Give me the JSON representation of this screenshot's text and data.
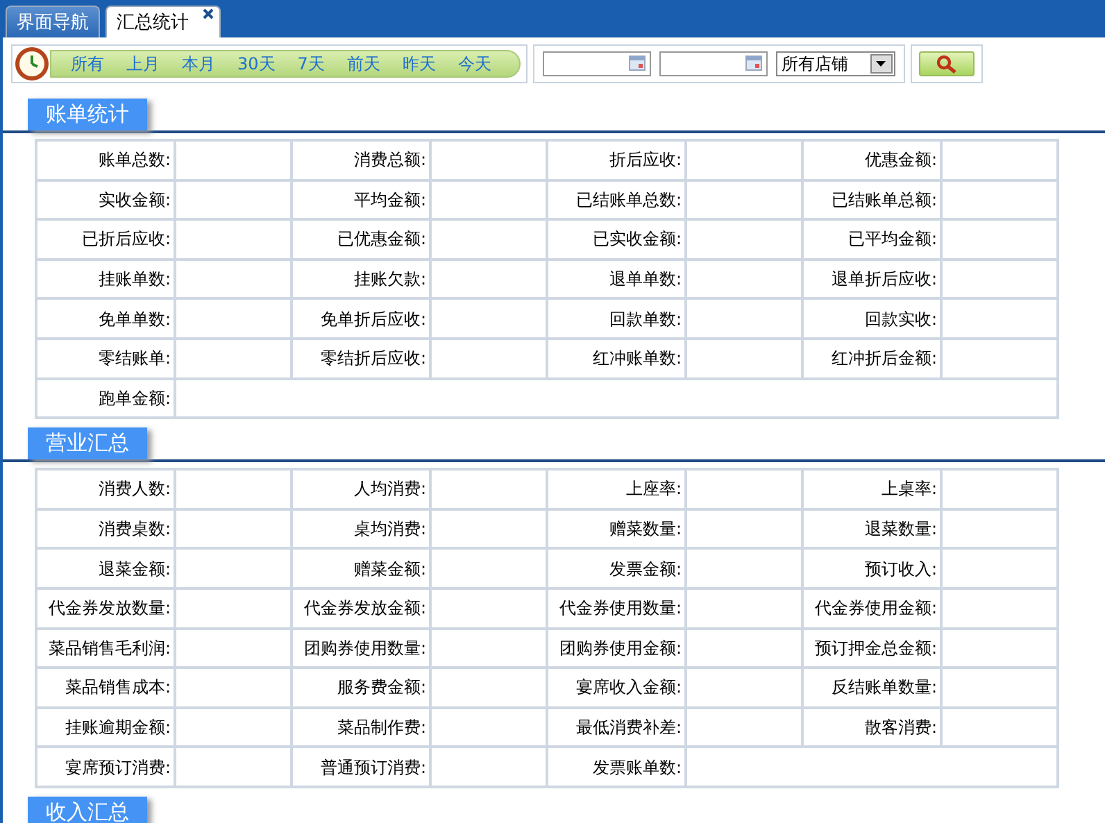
{
  "tabs": [
    {
      "label": "界面导航",
      "selected": false,
      "closable": false
    },
    {
      "label": "汇总统计",
      "selected": true,
      "closable": true
    }
  ],
  "toolbar": {
    "quick_ranges": [
      "所有",
      "上月",
      "本月",
      "30天",
      "7天",
      "前天",
      "昨天",
      "今天"
    ],
    "date_fields": [
      {
        "kind": "date"
      },
      {
        "kind": "date"
      }
    ],
    "store_select": {
      "value": "所有店铺"
    }
  },
  "sections": [
    {
      "title": "账单统计",
      "fields": [
        {
          "label": "账单总数:"
        },
        {
          "label": "消费总额:"
        },
        {
          "label": "折后应收:"
        },
        {
          "label": "优惠金额:"
        },
        {
          "label": "实收金额:"
        },
        {
          "label": "平均金额:"
        },
        {
          "label": "已结账单总数:"
        },
        {
          "label": "已结账单总额:"
        },
        {
          "label": "已折后应收:"
        },
        {
          "label": "已优惠金额:"
        },
        {
          "label": "已实收金额:"
        },
        {
          "label": "已平均金额:"
        },
        {
          "label": "挂账单数:"
        },
        {
          "label": "挂账欠款:"
        },
        {
          "label": "退单单数:"
        },
        {
          "label": "退单折后应收:"
        },
        {
          "label": "免单单数:"
        },
        {
          "label": "免单折后应收:"
        },
        {
          "label": "回款单数:"
        },
        {
          "label": "回款实收:"
        },
        {
          "label": "零结账单:"
        },
        {
          "label": "零结折后应收:"
        },
        {
          "label": "红冲账单数:"
        },
        {
          "label": "红冲折后金额:"
        },
        {
          "label": "跑单金额:"
        }
      ]
    },
    {
      "title": "营业汇总",
      "fields": [
        {
          "label": "消费人数:"
        },
        {
          "label": "人均消费:"
        },
        {
          "label": "上座率:"
        },
        {
          "label": "上桌率:"
        },
        {
          "label": "消费桌数:"
        },
        {
          "label": "桌均消费:"
        },
        {
          "label": "赠菜数量:"
        },
        {
          "label": "退菜数量:"
        },
        {
          "label": "退菜金额:"
        },
        {
          "label": "赠菜金额:"
        },
        {
          "label": "发票金额:"
        },
        {
          "label": "预订收入:"
        },
        {
          "label": "代金券发放数量:"
        },
        {
          "label": "代金券发放金额:"
        },
        {
          "label": "代金券使用数量:"
        },
        {
          "label": "代金券使用金额:"
        },
        {
          "label": "菜品销售毛利润:"
        },
        {
          "label": "团购券使用数量:"
        },
        {
          "label": "团购券使用金额:"
        },
        {
          "label": "预订押金总金额:"
        },
        {
          "label": "菜品销售成本:"
        },
        {
          "label": "服务费金额:"
        },
        {
          "label": "宴席收入金额:"
        },
        {
          "label": "反结账单数量:"
        },
        {
          "label": "挂账逾期金额:"
        },
        {
          "label": "菜品制作费:"
        },
        {
          "label": "最低消费补差:"
        },
        {
          "label": "散客消费:"
        },
        {
          "label": "宴席预订消费:"
        },
        {
          "label": "普通预订消费:"
        },
        {
          "label": "发票账单数:"
        }
      ]
    },
    {
      "title": "收入汇总"
    }
  ]
}
